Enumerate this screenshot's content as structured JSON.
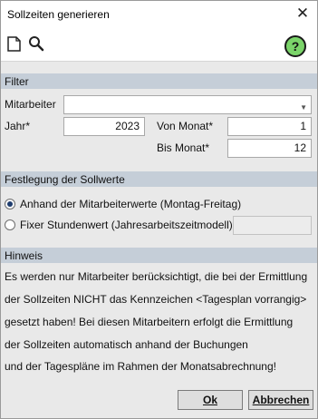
{
  "window": {
    "title": "Sollzeiten generieren"
  },
  "toolbar": {
    "new_icon": "document-icon",
    "search_icon": "search-icon",
    "help_label": "?"
  },
  "filter": {
    "header": "Filter",
    "mitarbeiter_label": "Mitarbeiter",
    "mitarbeiter_value": "",
    "jahr_label": "Jahr*",
    "jahr_value": "2023",
    "von_monat_label": "Von Monat*",
    "von_monat_value": "1",
    "bis_monat_label": "Bis Monat*",
    "bis_monat_value": "12"
  },
  "sollwerte": {
    "header": "Festlegung der Sollwerte",
    "option1_label": "Anhand der Mitarbeiterwerte (Montag-Freitag)",
    "option1_checked": true,
    "option2_label": "Fixer Stundenwert (Jahresarbeitszeitmodell)*",
    "option2_checked": false,
    "option2_value": ""
  },
  "hinweis": {
    "header": "Hinweis",
    "lines": [
      "Es werden nur Mitarbeiter berücksichtigt, die bei der Ermittlung",
      "der Sollzeiten NICHT das Kennzeichen <Tagesplan vorrangig>",
      "gesetzt haben! Bei diesen Mitarbeitern erfolgt die Ermittlung",
      "der Sollzeiten automatisch anhand der Buchungen",
      "und der Tagespläne im Rahmen der Monatsabrechnung!"
    ]
  },
  "buttons": {
    "ok_label": "Ok",
    "cancel_label": "Abbrechen"
  }
}
